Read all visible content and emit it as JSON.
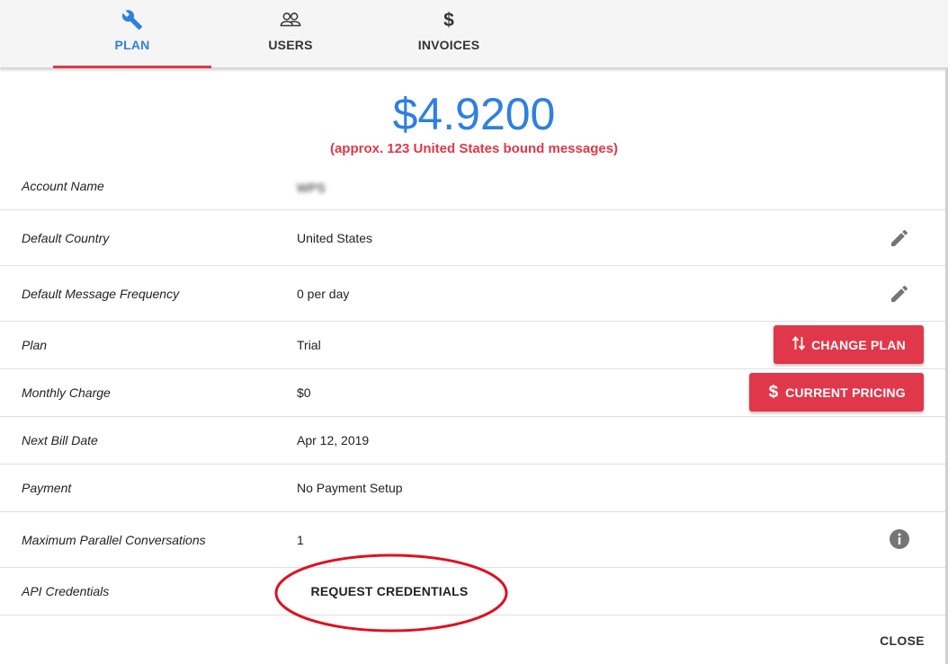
{
  "tabs": [
    {
      "label": "PLAN",
      "icon": "wrench-icon",
      "active": true
    },
    {
      "label": "USERS",
      "icon": "users-icon",
      "active": false
    },
    {
      "label": "INVOICES",
      "icon": "dollar-icon",
      "active": false
    }
  ],
  "balance": {
    "amount": "$4.9200",
    "approx": "(approx. 123 United States bound messages)"
  },
  "rows": {
    "account_name": {
      "label": "Account Name",
      "value": "WPS"
    },
    "default_country": {
      "label": "Default Country",
      "value": "United States"
    },
    "default_frequency": {
      "label": "Default Message Frequency",
      "value": "0 per day"
    },
    "plan": {
      "label": "Plan",
      "value": "Trial"
    },
    "monthly_charge": {
      "label": "Monthly Charge",
      "value": "$0"
    },
    "next_bill_date": {
      "label": "Next Bill Date",
      "value": "Apr 12, 2019"
    },
    "payment": {
      "label": "Payment",
      "value": "No Payment Setup"
    },
    "max_parallel": {
      "label": "Maximum Parallel Conversations",
      "value": "1"
    },
    "api_credentials": {
      "label": "API Credentials"
    }
  },
  "buttons": {
    "change_plan": "CHANGE PLAN",
    "current_pricing": "CURRENT PRICING",
    "request_credentials": "REQUEST CREDENTIALS",
    "close": "CLOSE"
  },
  "colors": {
    "accent_blue": "#2f80e0",
    "accent_red": "#e0384a",
    "annotation_red": "#e0101e"
  }
}
